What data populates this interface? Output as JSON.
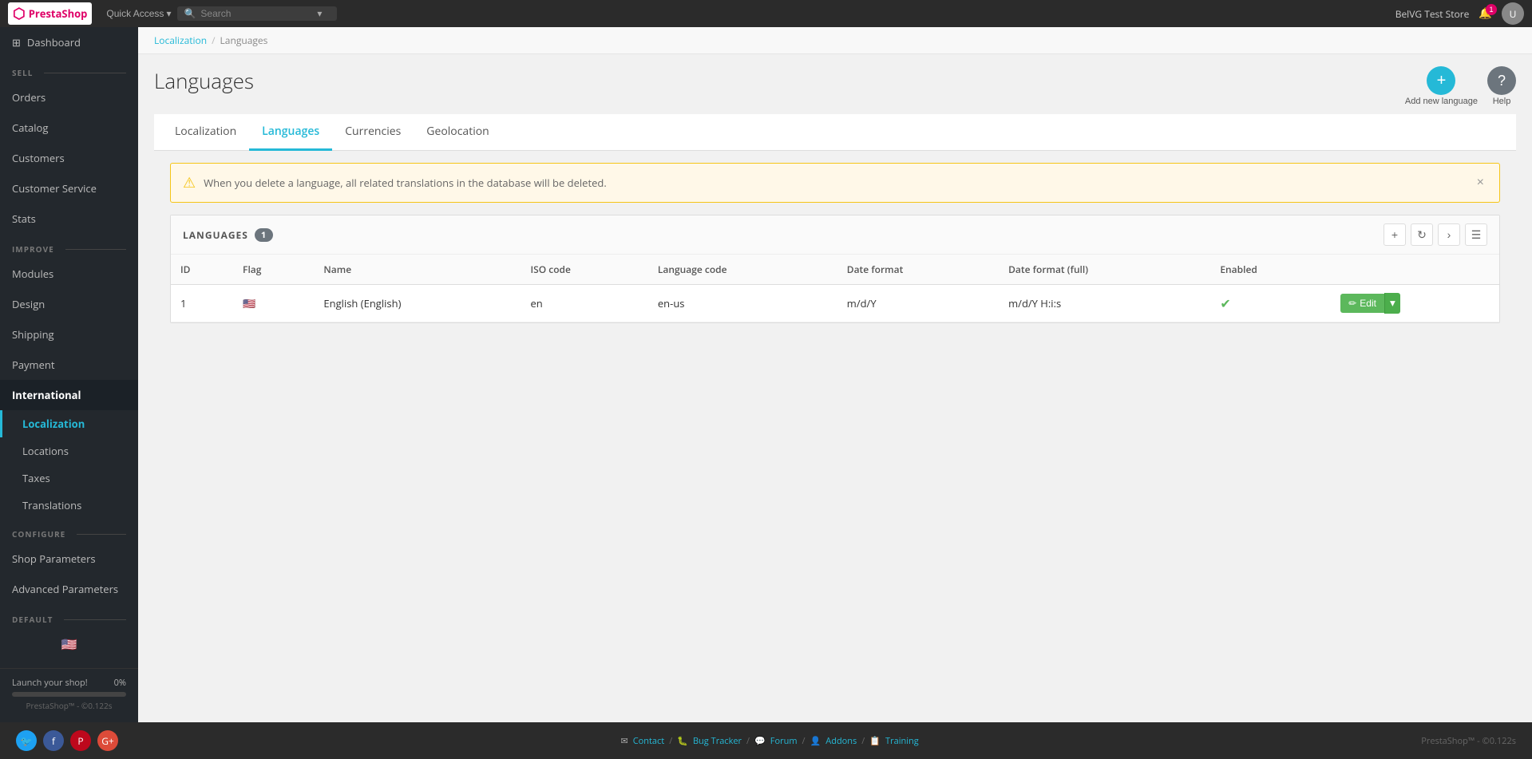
{
  "topnav": {
    "logo_text": "PrestaShop",
    "quick_access_label": "Quick Access",
    "search_placeholder": "Search",
    "store_name": "BelVG Test Store",
    "notif_count": "1",
    "avatar_initials": "U"
  },
  "sidebar": {
    "dashboard_label": "Dashboard",
    "sections": {
      "sell": "SELL",
      "improve": "IMPROVE",
      "configure": "CONFIGURE",
      "default": "DEFAULT"
    },
    "sell_items": [
      {
        "label": "Orders",
        "id": "orders"
      },
      {
        "label": "Catalog",
        "id": "catalog"
      },
      {
        "label": "Customers",
        "id": "customers"
      },
      {
        "label": "Customer Service",
        "id": "customer-service"
      },
      {
        "label": "Stats",
        "id": "stats"
      }
    ],
    "improve_items": [
      {
        "label": "Modules",
        "id": "modules"
      },
      {
        "label": "Design",
        "id": "design"
      },
      {
        "label": "Shipping",
        "id": "shipping"
      },
      {
        "label": "Payment",
        "id": "payment"
      },
      {
        "label": "International",
        "id": "international",
        "active": true
      }
    ],
    "international_sub": [
      {
        "label": "Localization",
        "id": "localization",
        "active": true
      },
      {
        "label": "Locations",
        "id": "locations"
      },
      {
        "label": "Taxes",
        "id": "taxes"
      },
      {
        "label": "Translations",
        "id": "translations"
      }
    ],
    "configure_items": [
      {
        "label": "Shop Parameters",
        "id": "shop-parameters"
      },
      {
        "label": "Advanced Parameters",
        "id": "advanced-parameters"
      }
    ],
    "progress_label": "Launch your shop!",
    "progress_value": "0%",
    "progress_pct": 0,
    "version": "PrestaShop™ - ©0.122s"
  },
  "breadcrumb": {
    "parent": "Localization",
    "current": "Languages"
  },
  "page": {
    "title": "Languages",
    "add_new_label": "Add new language",
    "help_label": "Help"
  },
  "tabs": [
    {
      "label": "Localization",
      "id": "localization"
    },
    {
      "label": "Languages",
      "id": "languages",
      "active": true
    },
    {
      "label": "Currencies",
      "id": "currencies"
    },
    {
      "label": "Geolocation",
      "id": "geolocation"
    }
  ],
  "warning": {
    "text": "When you delete a language, all related translations in the database will be deleted."
  },
  "table": {
    "section_label": "LANGUAGES",
    "count": "1",
    "columns": [
      {
        "key": "id",
        "label": "ID"
      },
      {
        "key": "flag",
        "label": "Flag"
      },
      {
        "key": "name",
        "label": "Name"
      },
      {
        "key": "iso_code",
        "label": "ISO code"
      },
      {
        "key": "language_code",
        "label": "Language code"
      },
      {
        "key": "date_format",
        "label": "Date format"
      },
      {
        "key": "date_format_full",
        "label": "Date format (full)"
      },
      {
        "key": "enabled",
        "label": "Enabled"
      }
    ],
    "rows": [
      {
        "id": "1",
        "flag": "🇺🇸",
        "name": "English (English)",
        "iso_code": "en",
        "language_code": "en-us",
        "date_format": "m/d/Y",
        "date_format_full": "m/d/Y H:i:s",
        "enabled": true,
        "edit_label": "Edit"
      }
    ]
  },
  "footer": {
    "social": [
      {
        "name": "twitter",
        "symbol": "🐦",
        "class": "social-twitter"
      },
      {
        "name": "facebook",
        "symbol": "f",
        "class": "social-facebook"
      },
      {
        "name": "pinterest",
        "symbol": "P",
        "class": "social-pinterest"
      },
      {
        "name": "google",
        "symbol": "G+",
        "class": "social-google"
      }
    ],
    "links": [
      {
        "label": "Contact",
        "icon": "✉"
      },
      {
        "label": "Bug Tracker",
        "icon": "🐛"
      },
      {
        "label": "Forum",
        "icon": "💬"
      },
      {
        "label": "Addons",
        "icon": "👤"
      },
      {
        "label": "Training",
        "icon": "📋"
      }
    ],
    "version_text": "PrestaShop™ - ©0.122s"
  }
}
